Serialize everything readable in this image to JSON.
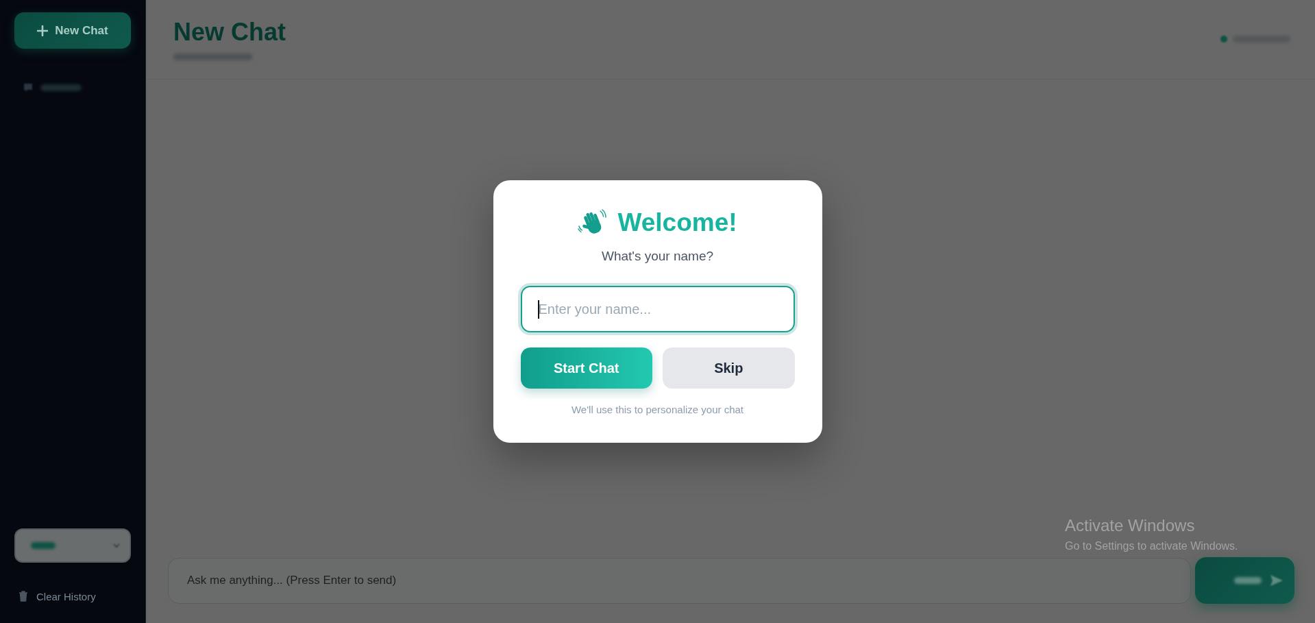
{
  "sidebar": {
    "new_chat_button": {
      "label": "New Chat"
    },
    "clear_history": {
      "label": "Clear History"
    }
  },
  "header": {
    "title": "New Chat"
  },
  "composer": {
    "placeholder": "Ask me anything... (Press Enter to send)"
  },
  "welcome_dialog": {
    "title": "Welcome!",
    "subtitle": "What's your name?",
    "name_field": {
      "placeholder": "Enter your name...",
      "focused": true
    },
    "buttons": [
      {
        "label": "Start Chat",
        "kind": "primary"
      },
      {
        "label": "Skip",
        "kind": "secondary"
      }
    ],
    "note": "We'll use this to personalize your chat"
  },
  "os_notice": {
    "title": "Activate Windows",
    "message": "Go to Settings to activate Windows."
  }
}
